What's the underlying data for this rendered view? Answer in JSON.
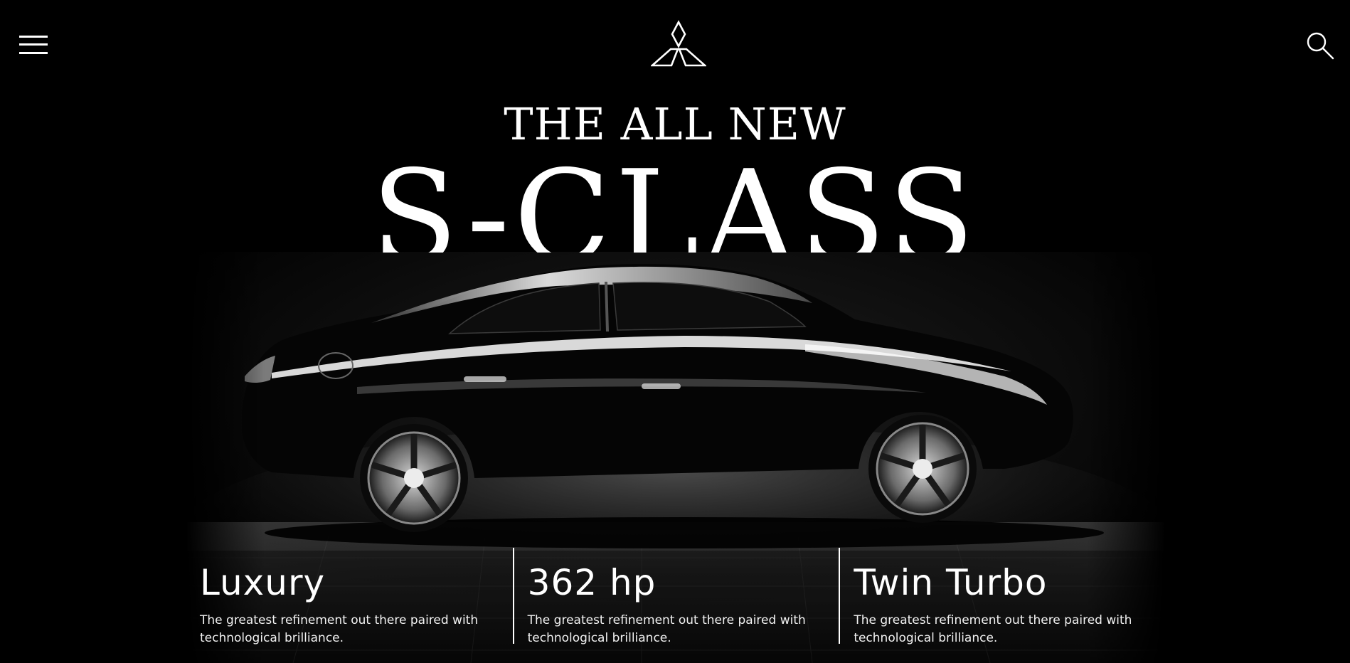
{
  "header": {
    "menu_icon": "hamburger-menu-icon",
    "logo_icon": "three-diamond-logo-icon",
    "search_icon": "search-icon"
  },
  "hero": {
    "kicker": "THE ALL NEW",
    "title": "S-CLASS",
    "image": "black-sedan-silhouette"
  },
  "features": [
    {
      "title": "Luxury",
      "description": "The greatest refinement out there paired with technological brilliance."
    },
    {
      "title": "362 hp",
      "description": "The greatest refinement out there paired with technological brilliance."
    },
    {
      "title": "Twin Turbo",
      "description": "The greatest refinement out there paired with technological brilliance."
    }
  ],
  "colors": {
    "background": "#000000",
    "text": "#ffffff",
    "divider": "#ffffff"
  }
}
